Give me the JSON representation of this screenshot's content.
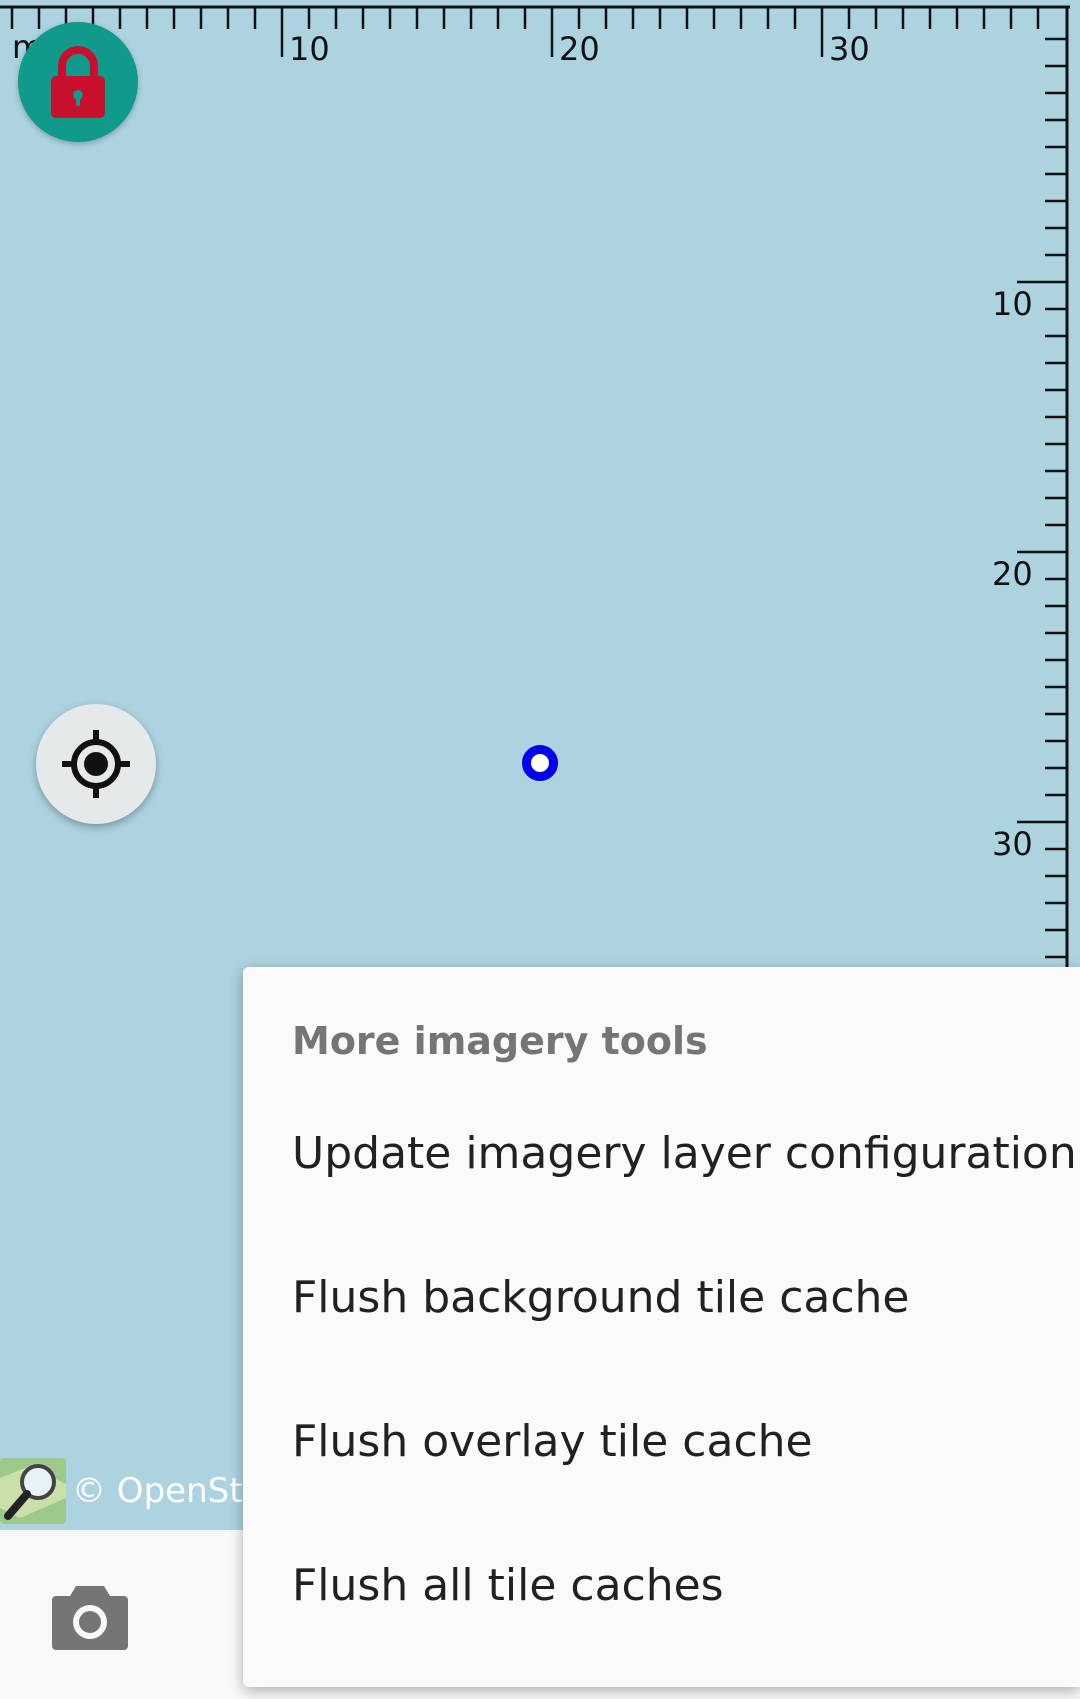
{
  "map": {
    "background_color": "#acd3df",
    "ruler": {
      "corner_label": "m",
      "top_labels": [
        "10",
        "20",
        "30"
      ],
      "right_labels": [
        "10",
        "20",
        "30"
      ]
    },
    "lock_button": {
      "icon": "lock-icon",
      "color": "#0f9a8c",
      "icon_color": "#c8102e"
    },
    "locate_button": {
      "icon": "crosshair-icon"
    },
    "position_marker": {
      "color": "#0000ee"
    },
    "attribution": {
      "icon": "osm-magnifier-icon",
      "text": "© OpenStre"
    }
  },
  "bottom_bar": {
    "camera_button": {
      "icon": "camera-icon"
    }
  },
  "menu": {
    "title": "More imagery tools",
    "items": [
      {
        "label": "Update imagery layer configuration"
      },
      {
        "label": "Flush background tile cache"
      },
      {
        "label": "Flush overlay tile cache"
      },
      {
        "label": "Flush all tile caches"
      }
    ]
  }
}
